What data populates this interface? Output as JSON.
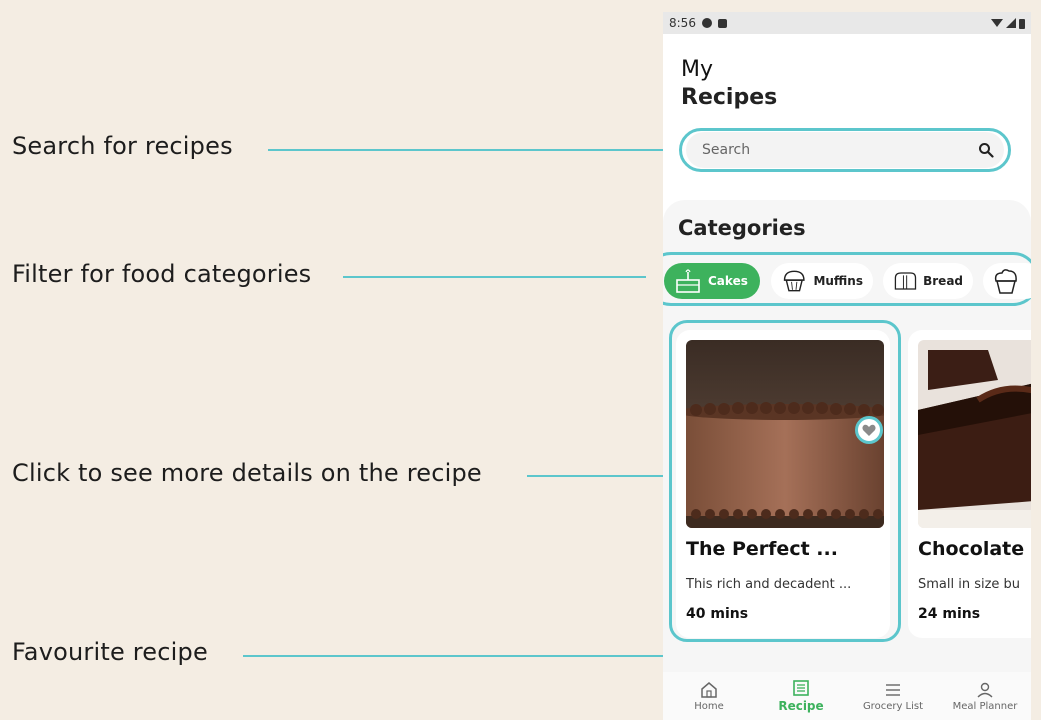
{
  "annotations": {
    "search": "Search for recipes",
    "filter": "Filter for food categories",
    "details": "Click to see more details on the recipe",
    "favourite": "Favourite recipe"
  },
  "status_bar": {
    "time": "8:56"
  },
  "header": {
    "line1": "My",
    "line2": "Recipes"
  },
  "search": {
    "placeholder": "Search"
  },
  "categories": {
    "title": "Categories",
    "items": [
      {
        "label": "Cakes",
        "icon": "cake-icon",
        "selected": true
      },
      {
        "label": "Muffins",
        "icon": "muffin-icon",
        "selected": false
      },
      {
        "label": "Bread",
        "icon": "bread-icon",
        "selected": false
      },
      {
        "label": "",
        "icon": "cupcake-icon",
        "selected": false
      }
    ]
  },
  "recipes": [
    {
      "title": "The Perfect ...",
      "description": "This rich and decadent ...",
      "time": "40 mins",
      "image": "chocolate-cake-photo"
    },
    {
      "title": "Chocolate",
      "description": "Small in size bu",
      "time": "24 mins",
      "image": "chocolate-cake-slice-photo"
    }
  ],
  "nav": {
    "items": [
      {
        "label": "Home",
        "icon": "home-icon"
      },
      {
        "label": "Recipe",
        "icon": "recipe-icon",
        "active": true
      },
      {
        "label": "Grocery List",
        "icon": "list-icon"
      },
      {
        "label": "Meal Planner",
        "icon": "person-icon"
      }
    ]
  },
  "colors": {
    "accent_line": "#5cc6cc",
    "active_green": "#3db25d",
    "background": "#f4ede3"
  }
}
